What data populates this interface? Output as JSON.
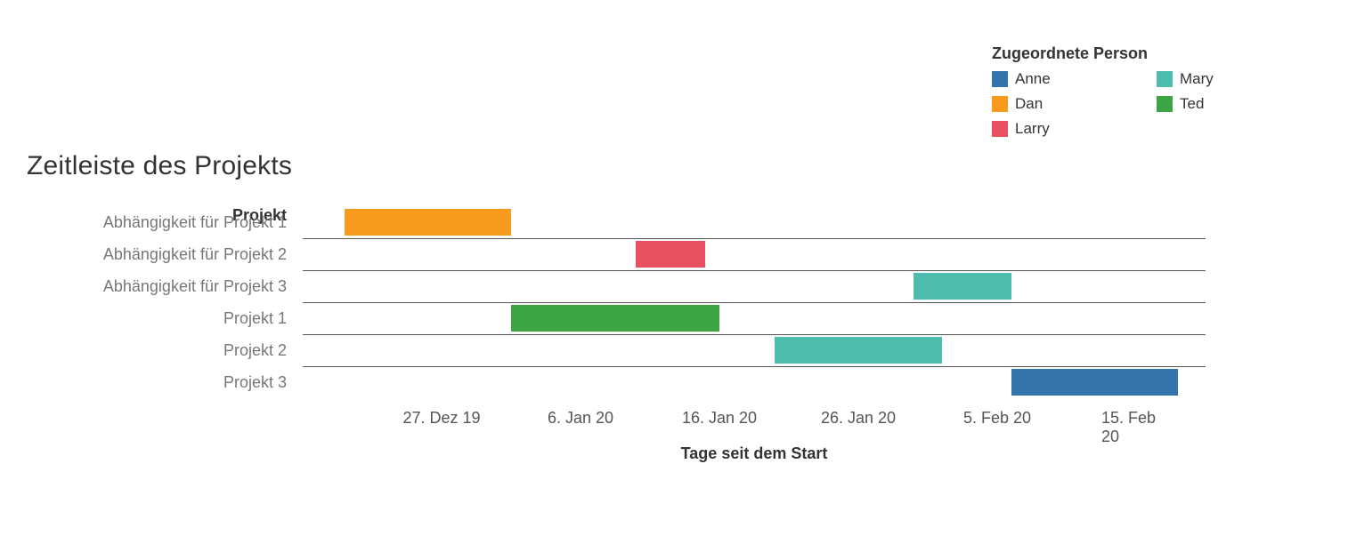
{
  "title": "Zeitleiste des Projekts",
  "legend_title": "Zugeordnete Person",
  "legend": [
    {
      "name": "Anne",
      "color": "#3374ad"
    },
    {
      "name": "Mary",
      "color": "#4dbeae"
    },
    {
      "name": "Dan",
      "color": "#f79a1e"
    },
    {
      "name": "Ted",
      "color": "#3ca443"
    },
    {
      "name": "Larry",
      "color": "#e9505f"
    }
  ],
  "y_axis_title": "Projekt",
  "x_axis_label": "Tage seit dem Start",
  "x_ticks": [
    "27. Dez 19",
    "6. Jan 20",
    "16. Jan 20",
    "26. Jan 20",
    "5. Feb 20",
    "15. Feb 20"
  ],
  "chart_data": {
    "type": "bar",
    "title": "Zeitleiste des Projekts",
    "xlabel": "Tage seit dem Start",
    "ylabel": "Projekt",
    "orientation": "horizontal_gantt",
    "color_by": "Zugeordnete Person",
    "x_range_dates": [
      "2019-12-17",
      "2020-02-20"
    ],
    "x_tick_labels": [
      "27. Dez 19",
      "6. Jan 20",
      "16. Jan 20",
      "26. Jan 20",
      "5. Feb 20",
      "15. Feb 20"
    ],
    "categories": [
      "Abhängigkeit für Projekt 1",
      "Abhängigkeit für Projekt 2",
      "Abhängigkeit für Projekt 3",
      "Projekt 1",
      "Projekt 2",
      "Projekt 3"
    ],
    "series": [
      {
        "category": "Abhängigkeit für Projekt 1",
        "person": "Dan",
        "color": "#f79a1e",
        "start": "2019-12-20",
        "end": "2020-01-01"
      },
      {
        "category": "Abhängigkeit für Projekt 2",
        "person": "Larry",
        "color": "#e9505f",
        "start": "2020-01-10",
        "end": "2020-01-15"
      },
      {
        "category": "Abhängigkeit für Projekt 3",
        "person": "Mary",
        "color": "#4dbeae",
        "start": "2020-01-30",
        "end": "2020-02-06"
      },
      {
        "category": "Projekt 1",
        "person": "Ted",
        "color": "#3ca443",
        "start": "2020-01-01",
        "end": "2020-01-16"
      },
      {
        "category": "Projekt 2",
        "person": "Mary",
        "color": "#4dbeae",
        "start": "2020-01-20",
        "end": "2020-02-01"
      },
      {
        "category": "Projekt 3",
        "person": "Anne",
        "color": "#3374ad",
        "start": "2020-02-06",
        "end": "2020-02-18"
      }
    ]
  }
}
